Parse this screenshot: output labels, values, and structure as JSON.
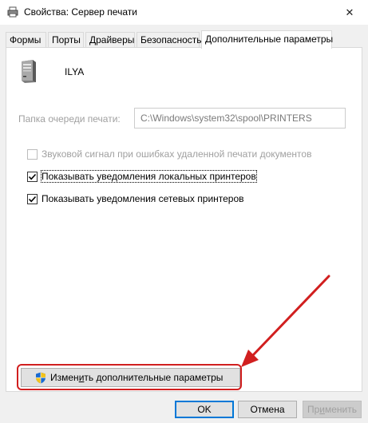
{
  "window": {
    "title": "Свойства: Сервер печати",
    "close_glyph": "✕"
  },
  "tabs": [
    {
      "label": "Формы",
      "active": false
    },
    {
      "label": "Порты",
      "active": false
    },
    {
      "label": "Драйверы",
      "active": false
    },
    {
      "label": "Безопасность",
      "active": false
    },
    {
      "label": "Дополнительные параметры",
      "active": true
    }
  ],
  "server": {
    "icon": "server-tower-icon",
    "name": "ILYA"
  },
  "spool": {
    "label": "Папка очереди печати:",
    "value": "C:\\Windows\\system32\\spool\\PRINTERS"
  },
  "options": [
    {
      "label": "Звуковой сигнал при ошибках удаленной печати документов",
      "checked": false,
      "enabled": false
    },
    {
      "label": "Показывать уведомления локальных принтеров",
      "checked": true,
      "enabled": true
    },
    {
      "label": "Показывать уведомления сетевых принтеров",
      "checked": true,
      "enabled": true
    }
  ],
  "change_button": {
    "icon": "uac-shield-icon",
    "label_pre": "Измен",
    "label_ul": "и",
    "label_post": "ть дополнительные параметры"
  },
  "buttons": {
    "ok": "OK",
    "cancel": "Отмена",
    "apply_pre": "Пр",
    "apply_ul": "и",
    "apply_post": "менить"
  },
  "colors": {
    "highlight": "#d11f1f",
    "accent": "#0078d7"
  }
}
